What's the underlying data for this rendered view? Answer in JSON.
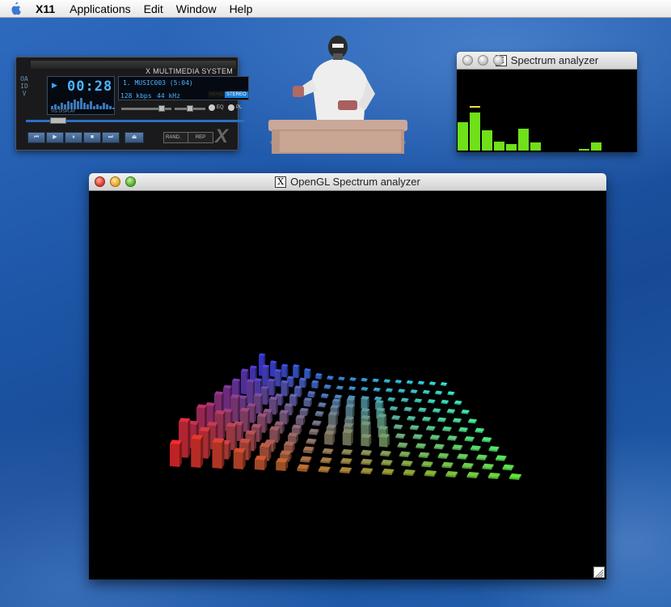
{
  "menubar": {
    "apple_icon": "apple-icon",
    "app_name": "X11",
    "items": [
      "Applications",
      "Edit",
      "Window",
      "Help"
    ]
  },
  "xmms": {
    "title": "X MULTIMEDIA SYSTEM",
    "time": "00:28",
    "song": "1. MUSIC003 (5:04)",
    "bitrate": "128 kbps",
    "samplerate": "44 kHz",
    "mono_label": "MONO",
    "stereo_label": "STEREO",
    "eq_label": "EQ",
    "pl_label": "PL",
    "shuffle_label": "RAND.",
    "repeat_label": "REP",
    "vis_label": "VIS DISPLAY",
    "controls": [
      "⏮",
      "▶",
      "⏸",
      "■",
      "⏭"
    ],
    "eject": "⏏",
    "seek_position": 0.12,
    "volume": 0.85,
    "balance": 0.5
  },
  "spectrum_small": {
    "title": "Spectrum analyzer",
    "bar_levels": [
      0.35,
      0.47,
      0.25,
      0.11,
      0.08,
      0.27,
      0.1,
      0,
      0,
      0,
      0.02,
      0.1,
      0,
      0
    ],
    "peak_index": 1,
    "peak_level": 0.55,
    "bar_color": "#6fe01a"
  },
  "spectrum_gl": {
    "title": "OpenGL Spectrum analyzer",
    "rows": 11,
    "cols": 17,
    "colors": {
      "front_left": "#e0282a",
      "back_left": "#3a3ad8",
      "front_right": "#5ad238",
      "back_right": "#2ad8c8"
    }
  }
}
